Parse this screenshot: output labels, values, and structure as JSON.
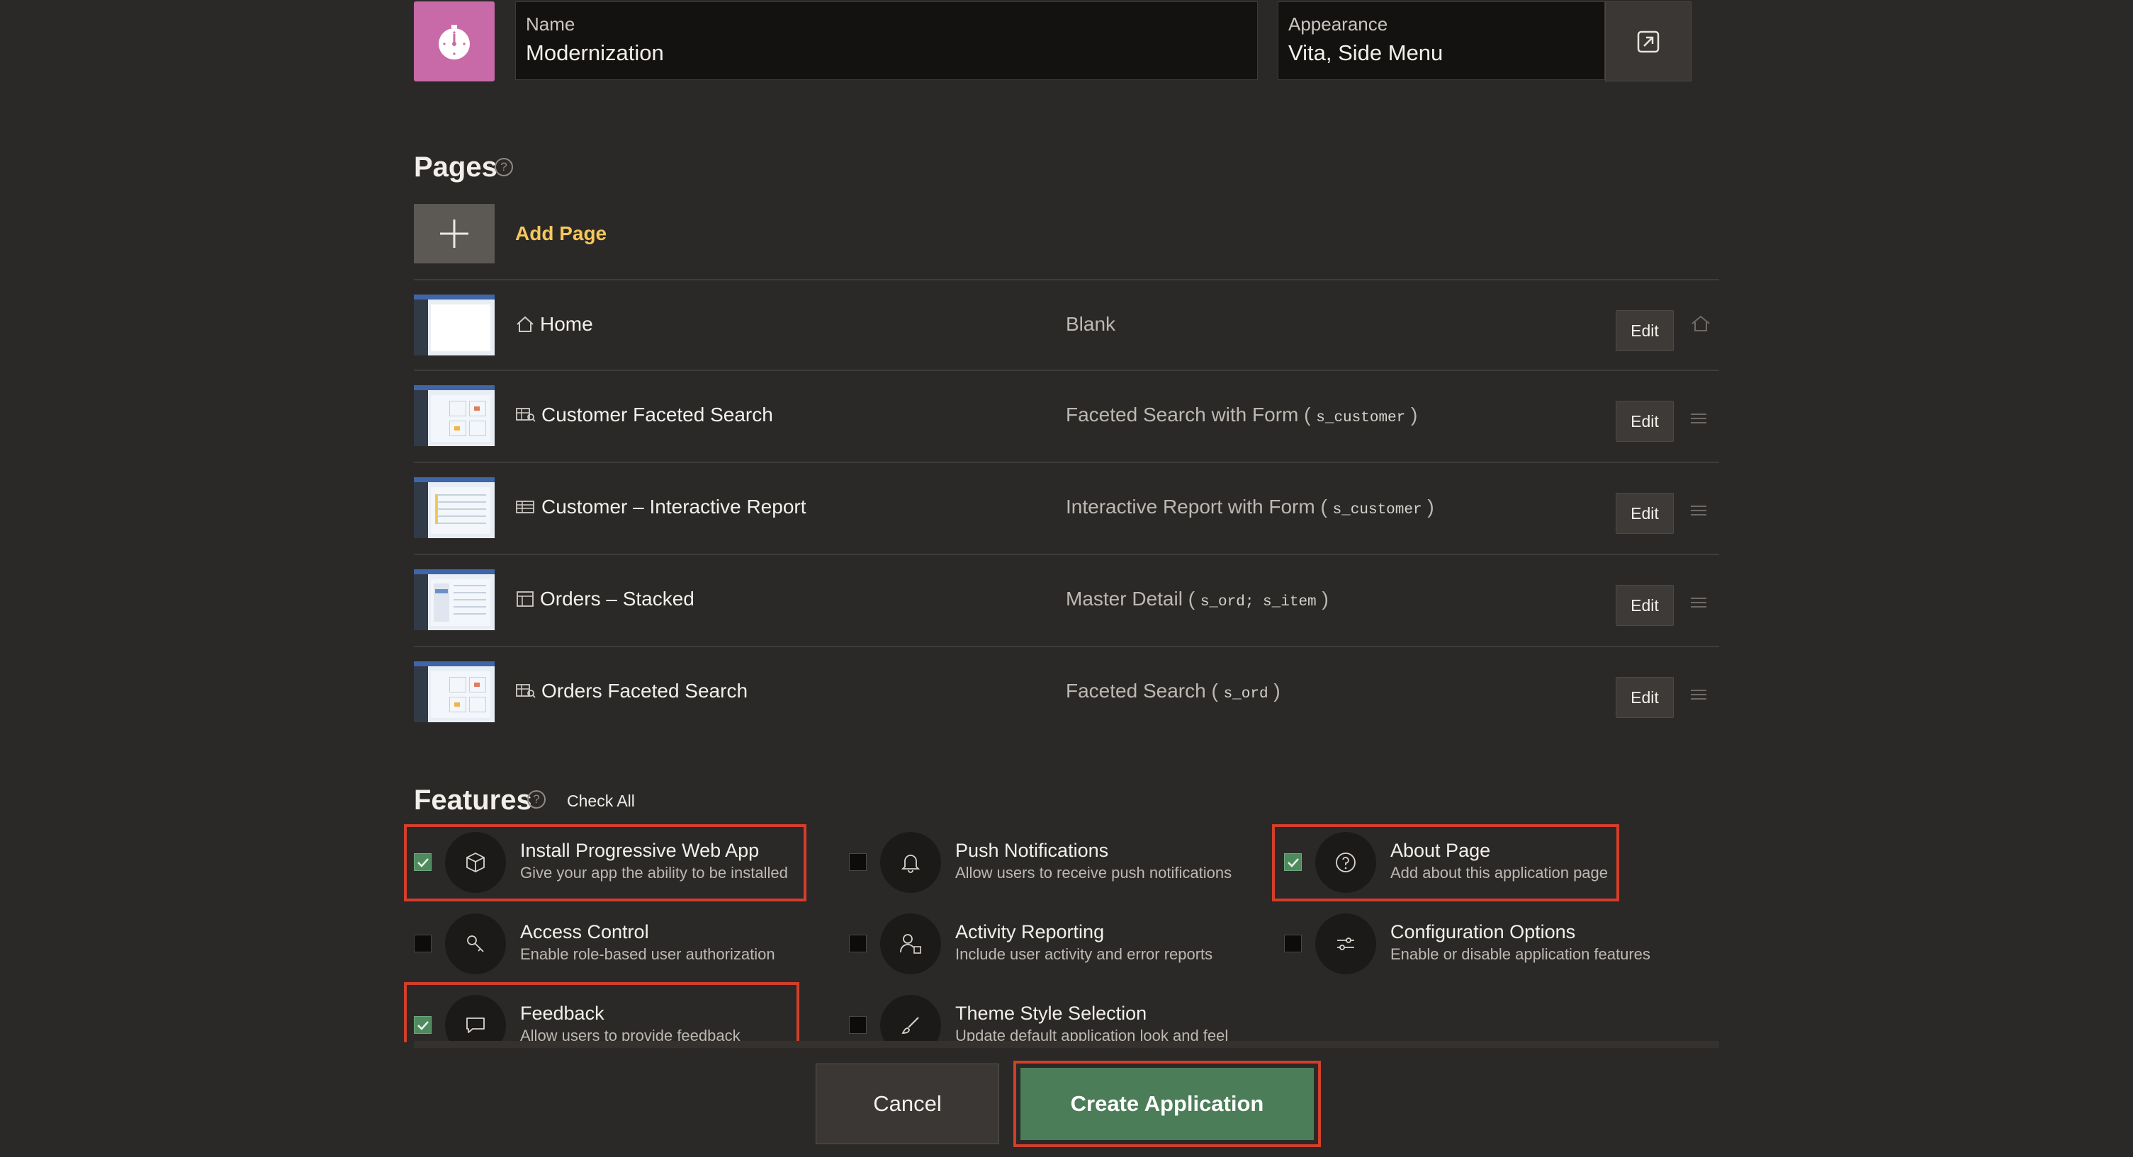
{
  "app": {
    "icon": "stopwatch-icon",
    "icon_color": "#c86aa8",
    "name_label": "Name",
    "name_value": "Modernization",
    "appearance_label": "Appearance",
    "appearance_value": "Vita, Side Menu"
  },
  "pages": {
    "title": "Pages",
    "add_page_label": "Add Page",
    "edit_label": "Edit",
    "rows": [
      {
        "title": "Home",
        "type": "Blank",
        "code": "",
        "icon": "home-icon"
      },
      {
        "title": "Customer Faceted Search",
        "type": "Faceted Search with Form (",
        "code": "s_customer",
        "close": ")",
        "icon": "faceted-search-icon"
      },
      {
        "title": "Customer – Interactive Report",
        "type": "Interactive Report with Form (",
        "code": "s_customer",
        "close": ")",
        "icon": "report-icon"
      },
      {
        "title": "Orders – Stacked",
        "type": "Master Detail (",
        "code": "s_ord; s_item",
        "close": ")",
        "icon": "stacked-icon"
      },
      {
        "title": "Orders Faceted Search",
        "type": "Faceted Search (",
        "code": "s_ord",
        "close": ")",
        "icon": "faceted-search-icon"
      }
    ]
  },
  "features": {
    "title": "Features",
    "check_all": "Check All",
    "items": [
      {
        "title": "Install Progressive Web App",
        "desc": "Give your app the ability to be installed",
        "checked": true,
        "icon": "box-icon"
      },
      {
        "title": "Push Notifications",
        "desc": "Allow users to receive push notifications",
        "checked": false,
        "icon": "bell-icon"
      },
      {
        "title": "About Page",
        "desc": "Add about this application page",
        "checked": true,
        "icon": "question-icon"
      },
      {
        "title": "Access Control",
        "desc": "Enable role-based user authorization",
        "checked": false,
        "icon": "key-icon"
      },
      {
        "title": "Activity Reporting",
        "desc": "Include user activity and error reports",
        "checked": false,
        "icon": "user-activity-icon"
      },
      {
        "title": "Configuration Options",
        "desc": "Enable or disable application features",
        "checked": false,
        "icon": "sliders-icon"
      },
      {
        "title": "Feedback",
        "desc": "Allow users to provide feedback",
        "checked": true,
        "icon": "speech-bubble-icon"
      },
      {
        "title": "Theme Style Selection",
        "desc": "Update default application look and feel",
        "checked": false,
        "icon": "brush-icon"
      }
    ]
  },
  "footer": {
    "cancel_label": "Cancel",
    "create_label": "Create Application"
  },
  "colors": {
    "accent_yellow": "#f5c75c",
    "create_green": "#4b7d58",
    "highlight_red": "#d23f2a"
  }
}
